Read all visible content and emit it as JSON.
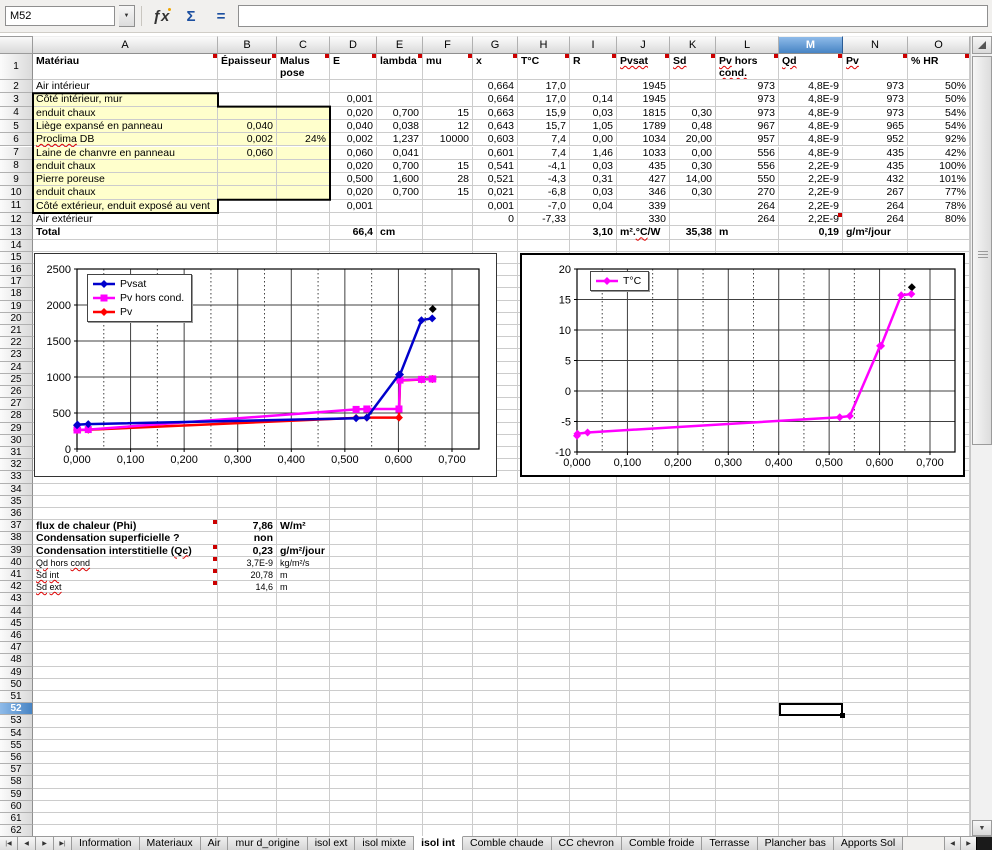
{
  "formula_bar": {
    "name_box": "M52",
    "formula_value": "",
    "dropdown_glyph": "▼",
    "function_wizard_glyph": "ƒx",
    "sum_glyph": "Σ",
    "equals_glyph": "="
  },
  "sheet": {
    "col_headers": [
      "A",
      "B",
      "C",
      "D",
      "E",
      "F",
      "G",
      "H",
      "I",
      "J",
      "K",
      "L",
      "M",
      "N",
      "O"
    ],
    "selected_column": "M",
    "selected_row": 52,
    "selected_cell": "M52",
    "visible_rows": 62,
    "cells": {
      "1": {
        "A": [
          "Matériau",
          "b m"
        ],
        "B": [
          "Épaisseur",
          "b m"
        ],
        "C": [
          "Malus pose",
          "b m"
        ],
        "D": [
          "E",
          "b m"
        ],
        "E": [
          "lambda",
          "b m"
        ],
        "F": [
          "mu",
          "b m"
        ],
        "G": [
          "x",
          "b m"
        ],
        "H": [
          "T°C",
          "b m"
        ],
        "I": [
          "R",
          "b m"
        ],
        "J": [
          "⟦Pvsat⟧",
          "b m"
        ],
        "K": [
          "⟦Sd⟧",
          "b m"
        ],
        "L": [
          "⟦Pv⟧ hors ⟦cond.⟧",
          "b m"
        ],
        "M": [
          "⟦Qd⟧",
          "b m"
        ],
        "N": [
          "⟦Pv⟧",
          "b m"
        ],
        "O": [
          "% HR",
          "b m"
        ]
      },
      "2": {
        "A": [
          "Air intérieur",
          ""
        ],
        "G": [
          "0,664",
          "r"
        ],
        "H": [
          "17,0",
          "r"
        ],
        "J": [
          "1945",
          "r"
        ],
        "L": [
          "973",
          "r"
        ],
        "M": [
          "4,8E-9",
          "r"
        ],
        "N": [
          "973",
          "r"
        ],
        "O": [
          "50%",
          "r"
        ]
      },
      "3": {
        "A": [
          "Côté intérieur, mur",
          "y"
        ],
        "D": [
          "0,001",
          "r"
        ],
        "G": [
          "0,664",
          "r"
        ],
        "H": [
          "17,0",
          "r"
        ],
        "I": [
          "0,14",
          "r"
        ],
        "J": [
          "1945",
          "r"
        ],
        "L": [
          "973",
          "r"
        ],
        "M": [
          "4,8E-9",
          "r"
        ],
        "N": [
          "973",
          "r"
        ],
        "O": [
          "50%",
          "r"
        ]
      },
      "4": {
        "A": [
          "enduit chaux",
          "y"
        ],
        "B": [
          "",
          "y"
        ],
        "C": [
          "",
          "y"
        ],
        "D": [
          "0,020",
          "r"
        ],
        "E": [
          "0,700",
          "r"
        ],
        "F": [
          "15",
          "r"
        ],
        "G": [
          "0,663",
          "r"
        ],
        "H": [
          "15,9",
          "r"
        ],
        "I": [
          "0,03",
          "r"
        ],
        "J": [
          "1815",
          "r"
        ],
        "K": [
          "0,30",
          "r"
        ],
        "L": [
          "973",
          "r"
        ],
        "M": [
          "4,8E-9",
          "r"
        ],
        "N": [
          "973",
          "r"
        ],
        "O": [
          "54%",
          "r"
        ]
      },
      "5": {
        "A": [
          "Liège expansé en panneau",
          "y"
        ],
        "B": [
          "0,040",
          "r y"
        ],
        "C": [
          "",
          "y"
        ],
        "D": [
          "0,040",
          "r"
        ],
        "E": [
          "0,038",
          "r"
        ],
        "F": [
          "12",
          "r"
        ],
        "G": [
          "0,643",
          "r"
        ],
        "H": [
          "15,7",
          "r"
        ],
        "I": [
          "1,05",
          "r"
        ],
        "J": [
          "1789",
          "r"
        ],
        "K": [
          "0,48",
          "r"
        ],
        "L": [
          "967",
          "r"
        ],
        "M": [
          "4,8E-9",
          "r"
        ],
        "N": [
          "965",
          "r"
        ],
        "O": [
          "54%",
          "r"
        ]
      },
      "6": {
        "A": [
          "⟦Proclima⟧ DB",
          "y"
        ],
        "B": [
          "0,002",
          "r y"
        ],
        "C": [
          "24%",
          "r y"
        ],
        "D": [
          "0,002",
          "r"
        ],
        "E": [
          "1,237",
          "r"
        ],
        "F": [
          "10000",
          "r"
        ],
        "G": [
          "0,603",
          "r"
        ],
        "H": [
          "7,4",
          "r"
        ],
        "I": [
          "0,00",
          "r"
        ],
        "J": [
          "1034",
          "r"
        ],
        "K": [
          "20,00",
          "r"
        ],
        "L": [
          "957",
          "r"
        ],
        "M": [
          "4,8E-9",
          "r"
        ],
        "N": [
          "952",
          "r"
        ],
        "O": [
          "92%",
          "r"
        ]
      },
      "7": {
        "A": [
          "Laine de chanvre en panneau",
          "y"
        ],
        "B": [
          "0,060",
          "r y"
        ],
        "C": [
          "",
          "y"
        ],
        "D": [
          "0,060",
          "r"
        ],
        "E": [
          "0,041",
          "r"
        ],
        "G": [
          "0,601",
          "r"
        ],
        "H": [
          "7,4",
          "r"
        ],
        "I": [
          "1,46",
          "r"
        ],
        "J": [
          "1033",
          "r"
        ],
        "K": [
          "0,00",
          "r"
        ],
        "L": [
          "556",
          "r"
        ],
        "M": [
          "4,8E-9",
          "r"
        ],
        "N": [
          "435",
          "r"
        ],
        "O": [
          "42%",
          "r"
        ]
      },
      "8": {
        "A": [
          "enduit chaux",
          "y"
        ],
        "B": [
          "",
          "y"
        ],
        "C": [
          "",
          "y"
        ],
        "D": [
          "0,020",
          "r"
        ],
        "E": [
          "0,700",
          "r"
        ],
        "F": [
          "15",
          "r"
        ],
        "G": [
          "0,541",
          "r"
        ],
        "H": [
          "-4,1",
          "r"
        ],
        "I": [
          "0,03",
          "r"
        ],
        "J": [
          "435",
          "r"
        ],
        "K": [
          "0,30",
          "r"
        ],
        "L": [
          "556",
          "r"
        ],
        "M": [
          "2,2E-9",
          "r"
        ],
        "N": [
          "435",
          "r"
        ],
        "O": [
          "100%",
          "r"
        ]
      },
      "9": {
        "A": [
          "Pierre poreuse",
          "y"
        ],
        "B": [
          "",
          "y"
        ],
        "C": [
          "",
          "y"
        ],
        "D": [
          "0,500",
          "r"
        ],
        "E": [
          "1,600",
          "r"
        ],
        "F": [
          "28",
          "r"
        ],
        "G": [
          "0,521",
          "r"
        ],
        "H": [
          "-4,3",
          "r"
        ],
        "I": [
          "0,31",
          "r"
        ],
        "J": [
          "427",
          "r"
        ],
        "K": [
          "14,00",
          "r"
        ],
        "L": [
          "550",
          "r"
        ],
        "M": [
          "2,2E-9",
          "r"
        ],
        "N": [
          "432",
          "r"
        ],
        "O": [
          "101%",
          "r"
        ]
      },
      "10": {
        "A": [
          "enduit chaux",
          "y"
        ],
        "B": [
          "",
          "y"
        ],
        "C": [
          "",
          "y"
        ],
        "D": [
          "0,020",
          "r"
        ],
        "E": [
          "0,700",
          "r"
        ],
        "F": [
          "15",
          "r"
        ],
        "G": [
          "0,021",
          "r"
        ],
        "H": [
          "-6,8",
          "r"
        ],
        "I": [
          "0,03",
          "r"
        ],
        "J": [
          "346",
          "r"
        ],
        "K": [
          "0,30",
          "r"
        ],
        "L": [
          "270",
          "r"
        ],
        "M": [
          "2,2E-9",
          "r"
        ],
        "N": [
          "267",
          "r"
        ],
        "O": [
          "77%",
          "r"
        ]
      },
      "11": {
        "A": [
          "Côté extérieur, enduit exposé au vent",
          "y"
        ],
        "D": [
          "0,001",
          "r"
        ],
        "G": [
          "0,001",
          "r"
        ],
        "H": [
          "-7,0",
          "r"
        ],
        "I": [
          "0,04",
          "r"
        ],
        "J": [
          "339",
          "r"
        ],
        "L": [
          "264",
          "r"
        ],
        "M": [
          "2,2E-9",
          "r"
        ],
        "N": [
          "264",
          "r"
        ],
        "O": [
          "78%",
          "r"
        ]
      },
      "12": {
        "A": [
          "Air extérieur",
          ""
        ],
        "G": [
          "0",
          "r"
        ],
        "H": [
          "-7,33",
          "r"
        ],
        "J": [
          "330",
          "r"
        ],
        "L": [
          "264",
          "r"
        ],
        "M": [
          "2,2E-9",
          "r m"
        ],
        "N": [
          "264",
          "r"
        ],
        "O": [
          "80%",
          "r"
        ]
      },
      "13": {
        "A": [
          "Total",
          "b"
        ],
        "D": [
          "66,4",
          "b r"
        ],
        "E": [
          "cm",
          "b"
        ],
        "I": [
          "3,10",
          "b r"
        ],
        "J": [
          "m².⟦°C⟧/W",
          "b"
        ],
        "K": [
          "35,38",
          "b r"
        ],
        "L": [
          "m",
          "b"
        ],
        "M": [
          "0,19",
          "b r"
        ],
        "N": [
          "g/m²/jour",
          "b"
        ]
      },
      "37": {
        "A": [
          "flux de chaleur (Phi)",
          "b m"
        ],
        "B": [
          "7,86",
          "b r"
        ],
        "C": [
          "W/m²",
          "b"
        ]
      },
      "38": {
        "A": [
          "Condensation superficielle ?",
          "b"
        ],
        "B": [
          "non",
          "b r"
        ]
      },
      "39": {
        "A": [
          "Condensation interstitielle (⟦Qc⟧)",
          "b m"
        ],
        "B": [
          "0,23",
          "b r"
        ],
        "C": [
          "g/m²/jour",
          "b"
        ]
      },
      "40": {
        "A": [
          "⟦Qd⟧ hors ⟦cond⟧",
          "s m"
        ],
        "B": [
          "3,7E-9",
          "s r"
        ],
        "C": [
          "kg/m²/s",
          "s"
        ]
      },
      "41": {
        "A": [
          "⟦Sd⟧ ⟦int⟧",
          "s m"
        ],
        "B": [
          "20,78",
          "s r"
        ],
        "C": [
          "m",
          "s"
        ]
      },
      "42": {
        "A": [
          "⟦Sd⟧ ⟦ext⟧",
          "s m"
        ],
        "B": [
          "14,6",
          "s r"
        ],
        "C": [
          "m",
          "s"
        ]
      }
    }
  },
  "chart_data": [
    {
      "id": "pv-chart",
      "type": "line",
      "title": "",
      "xlim": [
        0,
        0.7
      ],
      "x_frame_max": 0.75,
      "x_minor_step": 0.05,
      "ylim": [
        0,
        2500
      ],
      "xticks": {
        "values": [
          0,
          0.1,
          0.2,
          0.3,
          0.4,
          0.5,
          0.6,
          0.7
        ],
        "labels": [
          "0,000",
          "0,100",
          "0,200",
          "0,300",
          "0,400",
          "0,500",
          "0,600",
          "0,700"
        ]
      },
      "yticks": {
        "values": [
          0,
          500,
          1000,
          1500,
          2000,
          2500
        ],
        "labels": [
          "0",
          "500",
          "1000",
          "1500",
          "2000",
          "2500"
        ]
      },
      "legend_position": "top-left",
      "series": [
        {
          "name": "Pvsat",
          "color": "#0000cc",
          "marker": "diamond",
          "in_legend": true,
          "points": [
            [
              0,
              330
            ],
            [
              0.001,
              339
            ],
            [
              0.021,
              346
            ],
            [
              0.521,
              427
            ],
            [
              0.541,
              435
            ],
            [
              0.601,
              1033
            ],
            [
              0.603,
              1034
            ],
            [
              0.643,
              1789
            ],
            [
              0.663,
              1815
            ]
          ]
        },
        {
          "name": "Pv hors cond.",
          "color": "#ff00ff",
          "marker": "square",
          "in_legend": true,
          "points": [
            [
              0,
              264
            ],
            [
              0.001,
              264
            ],
            [
              0.021,
              270
            ],
            [
              0.521,
              550
            ],
            [
              0.541,
              556
            ],
            [
              0.601,
              556
            ],
            [
              0.603,
              957
            ],
            [
              0.643,
              967
            ],
            [
              0.663,
              973
            ],
            [
              0.664,
              973
            ]
          ]
        },
        {
          "name": "Pv",
          "color": "#ff0000",
          "marker": "diamond",
          "in_legend": true,
          "points": [
            [
              0,
              264
            ],
            [
              0.001,
              264
            ],
            [
              0.021,
              267
            ],
            [
              0.521,
              432
            ],
            [
              0.541,
              435
            ],
            [
              0.601,
              435
            ],
            [
              0.603,
              952
            ],
            [
              0.643,
              965
            ],
            [
              0.663,
              973
            ],
            [
              0.664,
              973
            ]
          ]
        },
        {
          "name": "end-point",
          "color": "#000000",
          "marker": "diamond",
          "in_legend": false,
          "points": [
            [
              0.664,
              1945
            ]
          ]
        }
      ]
    },
    {
      "id": "temp-chart",
      "type": "line",
      "title": "",
      "xlim": [
        0,
        0.7
      ],
      "x_frame_max": 0.75,
      "x_minor_step": 0.05,
      "ylim": [
        -10,
        20
      ],
      "xticks": {
        "values": [
          0,
          0.1,
          0.2,
          0.3,
          0.4,
          0.5,
          0.6,
          0.7
        ],
        "labels": [
          "0,000",
          "0,100",
          "0,200",
          "0,300",
          "0,400",
          "0,500",
          "0,600",
          "0,700"
        ]
      },
      "yticks": {
        "values": [
          -10,
          -5,
          0,
          5,
          10,
          15,
          20
        ],
        "labels": [
          "-10",
          "-5",
          "0",
          "5",
          "10",
          "15",
          "20"
        ]
      },
      "legend_position": "top-left",
      "series": [
        {
          "name": "T°C",
          "color": "#ff00ff",
          "marker": "diamond",
          "in_legend": true,
          "points": [
            [
              0,
              -7.33
            ],
            [
              0.001,
              -7.0
            ],
            [
              0.021,
              -6.8
            ],
            [
              0.521,
              -4.3
            ],
            [
              0.541,
              -4.1
            ],
            [
              0.601,
              7.4
            ],
            [
              0.603,
              7.4
            ],
            [
              0.643,
              15.7
            ],
            [
              0.663,
              15.9
            ]
          ]
        },
        {
          "name": "end-point",
          "color": "#000000",
          "marker": "diamond",
          "in_legend": false,
          "points": [
            [
              0.664,
              17
            ]
          ]
        }
      ]
    }
  ],
  "tab_bar": {
    "nav_glyphs": [
      "|◀",
      "◀",
      "▶",
      "▶|"
    ],
    "active_tab": "isol int",
    "tabs": [
      "Information",
      "Materiaux",
      "Air",
      "mur d_origine",
      "isol ext",
      "isol mixte",
      "isol int",
      "Comble chaude",
      "CC chevron",
      "Comble froide",
      "Terrasse",
      "Plancher bas",
      "Apports Sol"
    ],
    "scroll_glyphs": [
      "◀",
      "▶"
    ]
  }
}
